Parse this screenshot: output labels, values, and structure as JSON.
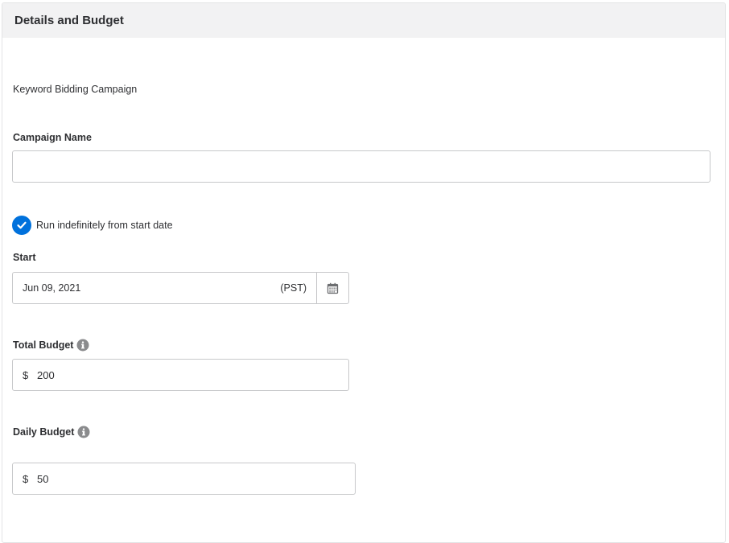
{
  "panel": {
    "title": "Details and Budget"
  },
  "campaign_type": "Keyword Bidding Campaign",
  "campaign_name": {
    "label": "Campaign Name",
    "value": "",
    "placeholder": ""
  },
  "run_indefinitely": {
    "label": "Run indefinitely from start date",
    "checked": true,
    "icon": "check-icon"
  },
  "start": {
    "label": "Start",
    "date": "Jun 09, 2021",
    "timezone": "(PST)",
    "icon": "calendar-icon"
  },
  "total_budget": {
    "label": "Total Budget",
    "currency": "$",
    "value": "200",
    "icon": "info-icon"
  },
  "daily_budget": {
    "label": "Daily Budget",
    "currency": "$",
    "value": "50",
    "icon": "info-icon"
  },
  "colors": {
    "accent": "#0071dc",
    "header_bg": "#f2f2f3",
    "border": "#c7c8ca",
    "text": "#2e2f32"
  }
}
